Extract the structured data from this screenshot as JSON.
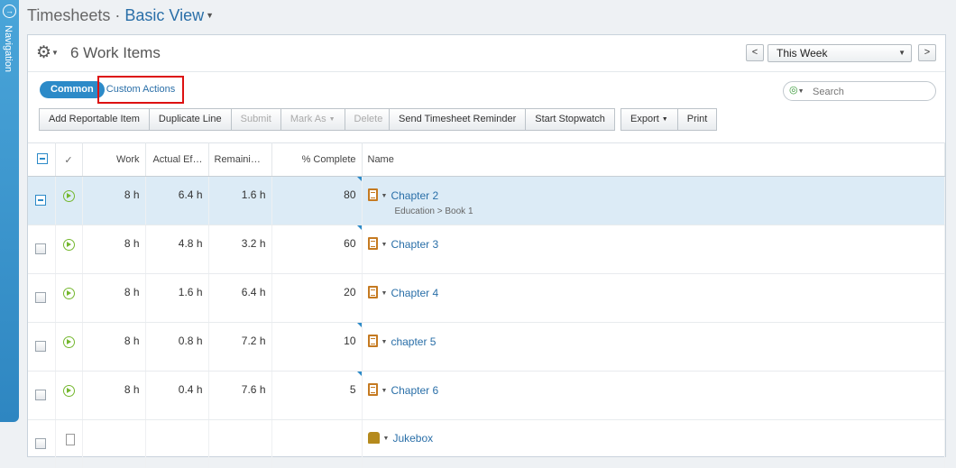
{
  "nav": {
    "label": "Navigation"
  },
  "header": {
    "title": "Timesheets",
    "separator": "·",
    "view": "Basic View"
  },
  "panel": {
    "items_count": "6 Work Items",
    "prev": "<",
    "next": ">",
    "period": "This Week"
  },
  "actions": {
    "tab_common": "Common",
    "tab_custom": "Custom Actions",
    "search_placeholder": "Search"
  },
  "toolbar": {
    "add_reportable": "Add Reportable Item",
    "duplicate_line": "Duplicate Line",
    "submit": "Submit",
    "mark_as": "Mark As",
    "delete": "Delete",
    "send_reminder": "Send Timesheet Reminder",
    "start_stopwatch": "Start Stopwatch",
    "export": "Export",
    "print": "Print"
  },
  "grid": {
    "columns": {
      "work": "Work",
      "actual_effort": "Actual Ef…",
      "remaining": "Remainin…",
      "percent_complete": "% Complete",
      "name": "Name"
    },
    "rows": [
      {
        "work": "8 h",
        "actual": "6.4 h",
        "remaining": "1.6 h",
        "complete": "80",
        "name": "Chapter 2",
        "path": "Education > Book 1"
      },
      {
        "work": "8 h",
        "actual": "4.8 h",
        "remaining": "3.2 h",
        "complete": "60",
        "name": "Chapter 3"
      },
      {
        "work": "8 h",
        "actual": "1.6 h",
        "remaining": "6.4 h",
        "complete": "20",
        "name": "Chapter 4"
      },
      {
        "work": "8 h",
        "actual": "0.8 h",
        "remaining": "7.2 h",
        "complete": "10",
        "name": "chapter 5"
      },
      {
        "work": "8 h",
        "actual": "0.4 h",
        "remaining": "7.6 h",
        "complete": "5",
        "name": "Chapter 6"
      },
      {
        "name": "Jukebox"
      }
    ]
  }
}
